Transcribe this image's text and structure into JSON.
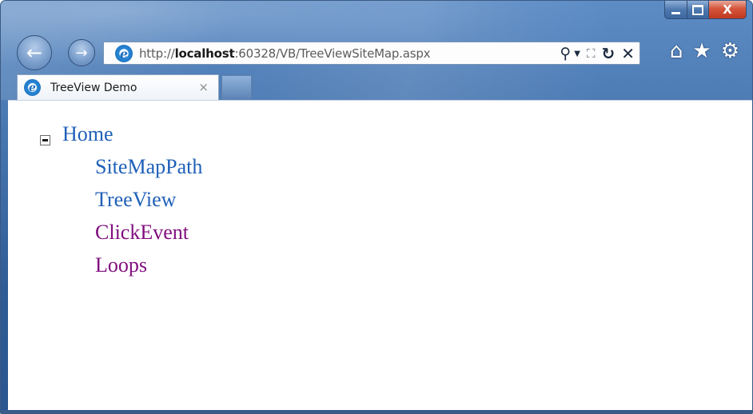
{
  "window": {
    "caption": {
      "minimize_glyph": "",
      "maximize_glyph": "",
      "close_glyph": "X"
    }
  },
  "toolbar": {
    "back_glyph": "←",
    "forward_glyph": "→",
    "address": {
      "prefix": "http://",
      "host": "localhost",
      "rest": ":60328/VB/TreeViewSiteMap.aspx"
    },
    "icons": [
      "search-icon",
      "dropdown-icon",
      "compatibility-view-icon",
      "refresh-icon",
      "stop-icon",
      "home-icon",
      "favorites-icon",
      "tools-gear-icon"
    ]
  },
  "tabs": [
    {
      "title": "TreeView Demo",
      "close_glyph": "×"
    }
  ],
  "tree": {
    "root": {
      "label": "Home",
      "expanded": true
    },
    "children": [
      {
        "label": "SiteMapPath",
        "visited": false
      },
      {
        "label": "TreeView",
        "visited": false
      },
      {
        "label": "ClickEvent",
        "visited": true
      },
      {
        "label": "Loops",
        "visited": true
      }
    ]
  },
  "colors": {
    "link": "#2060b8",
    "visited_link": "#800f7f",
    "frame": "#2f5c94",
    "close_button": "#c0391f"
  }
}
